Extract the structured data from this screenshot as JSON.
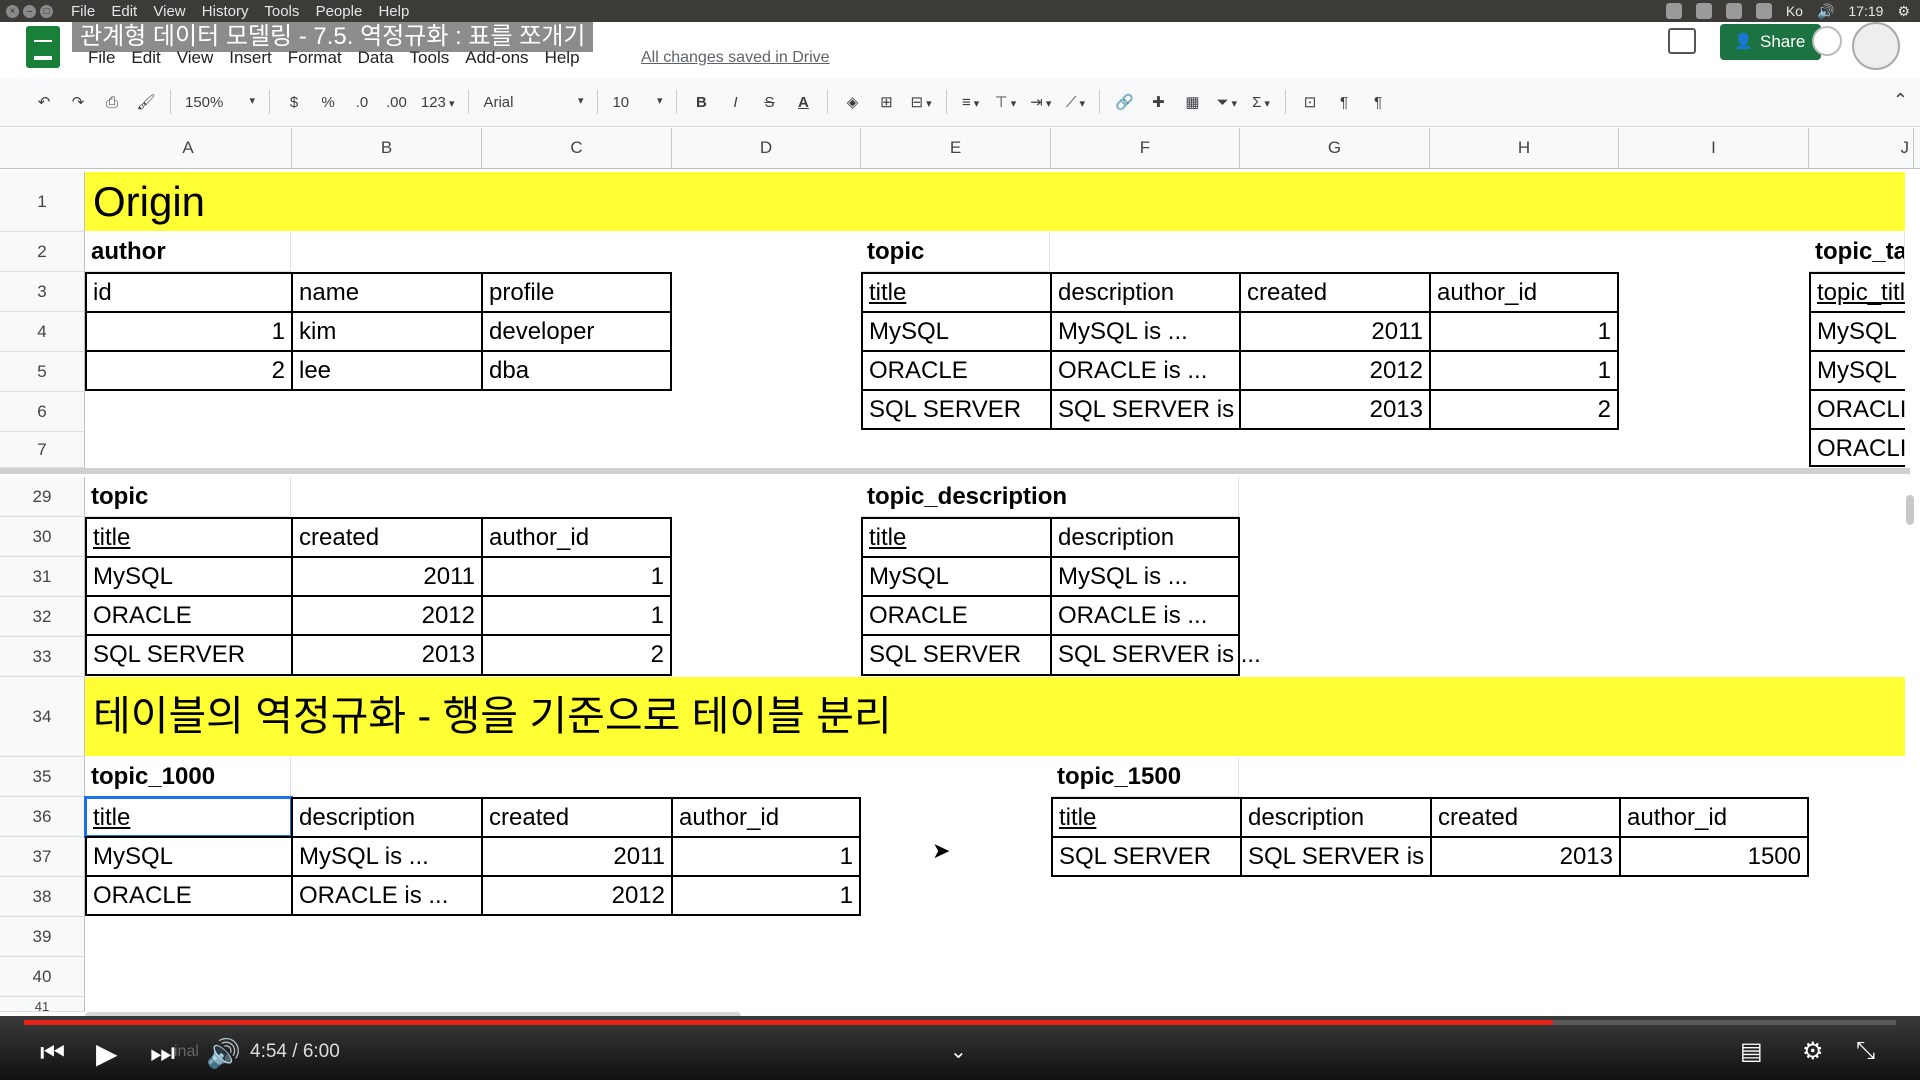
{
  "os_bar": {
    "menu": [
      "File",
      "Edit",
      "View",
      "History",
      "Tools",
      "People",
      "Help"
    ],
    "time": "17:19",
    "keyboard": "Ko"
  },
  "doc": {
    "title": "관계형 데이터 모델링 - 7.5. 역정규화 : 표를 쪼개기",
    "menu": [
      "File",
      "Edit",
      "View",
      "Insert",
      "Format",
      "Data",
      "Tools",
      "Add-ons",
      "Help"
    ],
    "saved_status": "All changes saved in Drive",
    "share_label": "Share"
  },
  "toolbar": {
    "zoom": "150%",
    "currency": "$",
    "percent": "%",
    "dec_decrease": ".0",
    "dec_increase": ".00",
    "format_more": "123",
    "font": "Arial",
    "font_size": "10",
    "bold": "B",
    "italic": "I",
    "strike": "S",
    "text_color": "A"
  },
  "columns": [
    "A",
    "B",
    "C",
    "D",
    "E",
    "F",
    "G",
    "H",
    "I",
    "J"
  ],
  "rows": [
    "1",
    "2",
    "3",
    "4",
    "5",
    "6",
    "7",
    "29",
    "30",
    "31",
    "32",
    "33",
    "34",
    "35",
    "36",
    "37",
    "38",
    "39",
    "40",
    "41"
  ],
  "sheet": {
    "band1": "Origin",
    "author_title": "author",
    "author_headers": [
      "id",
      "name",
      "profile"
    ],
    "author_rows": [
      [
        "1",
        "kim",
        "developer"
      ],
      [
        "2",
        "lee",
        "dba"
      ]
    ],
    "topic_title": "topic",
    "topic_headers": [
      "title",
      "description",
      "created",
      "author_id"
    ],
    "topic_rows": [
      [
        "MySQL",
        "MySQL is ...",
        "2011",
        "1"
      ],
      [
        "ORACLE",
        "ORACLE is ...",
        "2012",
        "1"
      ],
      [
        "SQL SERVER",
        "SQL SERVER is",
        "2013",
        "2"
      ]
    ],
    "topic_tag_title": "topic_ta",
    "topic_tag_header": "topic_titl",
    "topic_tag_rows": [
      "MySQL",
      "MySQL",
      "ORACLI",
      "ORACLI"
    ],
    "topic2_title": "topic",
    "topic2_headers": [
      "title",
      "created",
      "author_id"
    ],
    "topic2_rows": [
      [
        "MySQL",
        "2011",
        "1"
      ],
      [
        "ORACLE",
        "2012",
        "1"
      ],
      [
        "SQL SERVER",
        "2013",
        "2"
      ]
    ],
    "topic_desc_title": "topic_description",
    "topic_desc_headers": [
      "title",
      "description"
    ],
    "topic_desc_rows": [
      [
        "MySQL",
        "MySQL is ..."
      ],
      [
        "ORACLE",
        "ORACLE is ..."
      ],
      [
        "SQL SERVER",
        "SQL SERVER is ..."
      ]
    ],
    "band2": "테이블의 역정규화 - 행을 기준으로 테이블 분리",
    "t1000_title": "topic_1000",
    "t1000_headers": [
      "title",
      "description",
      "created",
      "author_id"
    ],
    "t1000_rows": [
      [
        "MySQL",
        "MySQL is ...",
        "2011",
        "1"
      ],
      [
        "ORACLE",
        "ORACLE is ...",
        "2012",
        "1"
      ]
    ],
    "t1500_title": "topic_1500",
    "t1500_headers": [
      "title",
      "description",
      "created",
      "author_id"
    ],
    "t1500_rows": [
      [
        "SQL SERVER",
        "SQL SERVER is",
        "2013",
        "1500"
      ]
    ]
  },
  "player": {
    "time": "4:54 / 6:00",
    "progress_fraction": 0.817,
    "next_label": "inal"
  }
}
